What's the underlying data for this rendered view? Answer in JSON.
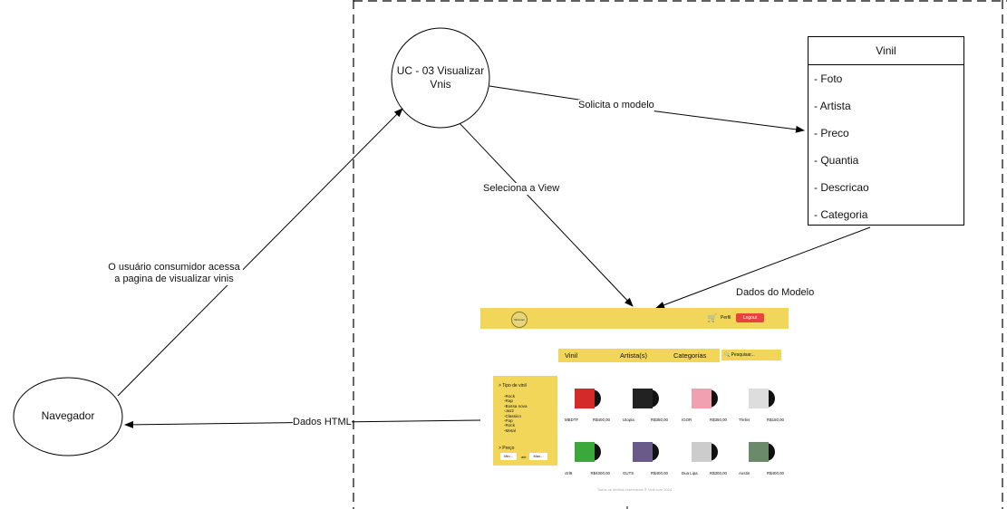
{
  "use_case": "UC - 03 Visualizar Vnis",
  "actor": "Navegador",
  "model": {
    "title": "Vinil",
    "attributes": [
      "- Foto",
      "- Artista",
      "- Preco",
      "- Quantia",
      "- Descricao",
      "- Categoria"
    ]
  },
  "edges": {
    "user_access": "O usuário consumidor acessa a pagina de visualizar vinis",
    "request_model": "Solicita o modelo",
    "select_view": "Seleciona a View",
    "model_data": "Dados do Modelo",
    "html_data": "Dados HTML"
  },
  "mockup": {
    "logo": "Vinil.com",
    "perfil": "Perfil",
    "logout": "Logout",
    "nav": [
      "Vinil",
      "Artista(s)",
      "Categorias"
    ],
    "search_placeholder": "Pesquisar...",
    "filter_type_title": "> Tipo de vinil",
    "genres": [
      "-Rock",
      "-Rap",
      "-Bossa nova",
      "-Jazz",
      "-Classico",
      "-Pop",
      "-Rock",
      "-Metal"
    ],
    "filter_price_title": "> Preço",
    "min_label": "Min...",
    "ate_label": "até",
    "max_label": "Max...",
    "products": [
      {
        "name": "MBDTF",
        "price": "R$400,00",
        "color": "#d42a2a"
      },
      {
        "name": "Utopia",
        "price": "R$350,00",
        "color": "#222222"
      },
      {
        "name": "IGOR",
        "price": "R$350,00",
        "color": "#f0a0b0"
      },
      {
        "name": "Thriler",
        "price": "R$150,00",
        "color": "#dddddd"
      },
      {
        "name": "ctrl8",
        "price": "R$4000,00",
        "color": "#3aa83a"
      },
      {
        "name": "GUTS",
        "price": "R$400,00",
        "color": "#6a5a8a"
      },
      {
        "name": "Dua Lipa",
        "price": "R$300,00",
        "color": "#cccccc"
      },
      {
        "name": "Austin",
        "price": "R$400,00",
        "color": "#6a8a6a"
      }
    ],
    "footer": "Todos os direitos reservados ® Vinil.com 2024"
  }
}
